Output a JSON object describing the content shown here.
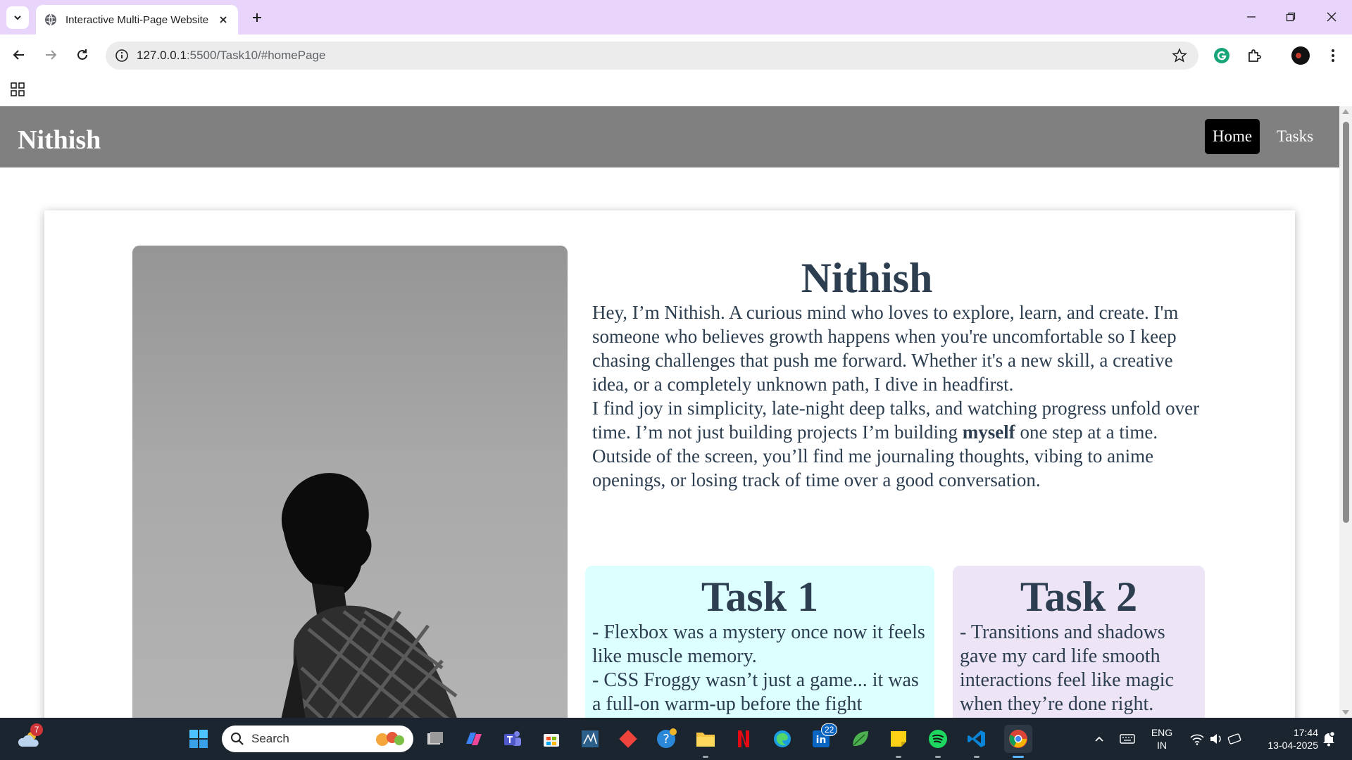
{
  "browser": {
    "tab_title": "Interactive Multi-Page Website",
    "url_host": "127.0.0.1",
    "url_rest": ":5500/Task10/#homePage"
  },
  "site": {
    "logo": "Nithish",
    "nav": {
      "home": "Home",
      "tasks": "Tasks"
    }
  },
  "about": {
    "title": "Nithish",
    "p1": "Hey, I’m Nithish. A curious mind who loves to explore, learn, and create. I'm someone who believes growth happens when you're uncomfortable so I keep chasing challenges that push me forward. Whether it's a new skill, a creative idea, or a completely unknown path, I dive in headfirst.",
    "p2_before": "I find joy in simplicity, late-night deep talks, and watching progress unfold over time. I’m not just building projects I’m building ",
    "p2_bold": "myself",
    "p2_after": " one step at a time.",
    "p3": "Outside of the screen, you’ll find me journaling thoughts, vibing to anime openings, or losing track of time over a good conversation."
  },
  "tasks": [
    {
      "title": "Task 1",
      "lines": [
        "- Flexbox was a mystery once now it feels like muscle memory.",
        "- CSS Froggy wasn’t just a game... it was a full-on warm-up before the fight"
      ]
    },
    {
      "title": "Task 2",
      "lines": [
        "- Transitions and shadows gave my card life smooth interactions feel like magic when they’re done right."
      ]
    }
  ],
  "taskbar": {
    "weather_badge": "7",
    "search_placeholder": "Search",
    "linkedin_badge": "22",
    "lang_line1": "ENG",
    "lang_line2": "IN",
    "time": "17:44",
    "date": "13-04-2025"
  },
  "colors": {
    "tabstrip": "#e9d5fb",
    "header_bg": "#808080",
    "text_dark": "#2c3e50",
    "task1_bg": "#dcffff",
    "task2_bg": "#ede4f6",
    "taskbar_bg": "#1b2530"
  }
}
